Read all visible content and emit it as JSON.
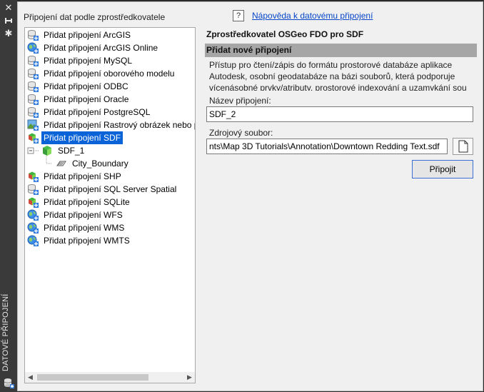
{
  "sidebar": {
    "title": "DATOVÉ PŘIPOJENÍ",
    "icons": [
      "close-icon",
      "pin-icon",
      "settings-icon",
      "database-icon"
    ]
  },
  "tree": {
    "label": "Připojení dat podle zprostředkovatele",
    "items": [
      {
        "label": "Přidat připojení ArcGIS",
        "icon": "db-plus-icon",
        "level": 0
      },
      {
        "label": "Přidat připojení ArcGIS Online",
        "icon": "globe-plus-icon",
        "level": 0
      },
      {
        "label": "Přidat připojení MySQL",
        "icon": "db-plus-icon",
        "level": 0
      },
      {
        "label": "Přidat připojení oborového modelu",
        "icon": "db-plus-icon",
        "level": 0
      },
      {
        "label": "Přidat připojení ODBC",
        "icon": "db-plus-icon",
        "level": 0
      },
      {
        "label": "Přidat připojení Oracle",
        "icon": "db-plus-icon",
        "level": 0
      },
      {
        "label": "Přidat připojení PostgreSQL",
        "icon": "db-plus-icon",
        "level": 0
      },
      {
        "label": "Přidat připojení Rastrový obrázek nebo p",
        "icon": "raster-plus-icon",
        "level": 0
      },
      {
        "label": "Přidat připojení SDF",
        "icon": "cube-plus-icon",
        "level": 0,
        "selected": true
      },
      {
        "label": "SDF_1",
        "icon": "cube-icon",
        "level": 1
      },
      {
        "label": "City_Boundary",
        "icon": "layer-icon",
        "level": 2
      },
      {
        "label": "Přidat připojení SHP",
        "icon": "cube-plus-icon",
        "level": 0
      },
      {
        "label": "Přidat připojení SQL Server Spatial",
        "icon": "db-plus-icon",
        "level": 0
      },
      {
        "label": "Přidat připojení SQLite",
        "icon": "cube-plus-icon",
        "level": 0
      },
      {
        "label": "Přidat připojení WFS",
        "icon": "globe-plus-icon",
        "level": 0
      },
      {
        "label": "Přidat připojení WMS",
        "icon": "globe-plus-icon",
        "level": 0
      },
      {
        "label": "Přidat připojení WMTS",
        "icon": "globe-plus-icon",
        "level": 0
      }
    ]
  },
  "help": {
    "icon": "?",
    "link": "Nápověda k datovému připojení"
  },
  "provider": {
    "title": "Zprostředkovatel OSGeo FDO pro SDF",
    "section": "Přidat nové připojení",
    "description": "Přístup pro čtení/zápis do formátu prostorové databáze aplikace Autodesk, osobní geodatabáze na bázi souborů, která podporuje vícenásobné prvky/atributy, prostorové indexování a uzamykání sou",
    "name_label": "Název připojení:",
    "name_value": "SDF_2",
    "source_label": "Zdrojový soubor:",
    "source_value": "nts\\Map 3D Tutorials\\Annotation\\Downtown Redding Text.sdf",
    "connect_label": "Připojit"
  },
  "colors": {
    "selection": "#0a64d8",
    "link": "#0645c8",
    "section_header": "#a6a6a6",
    "button_border": "#3c6fd6"
  }
}
